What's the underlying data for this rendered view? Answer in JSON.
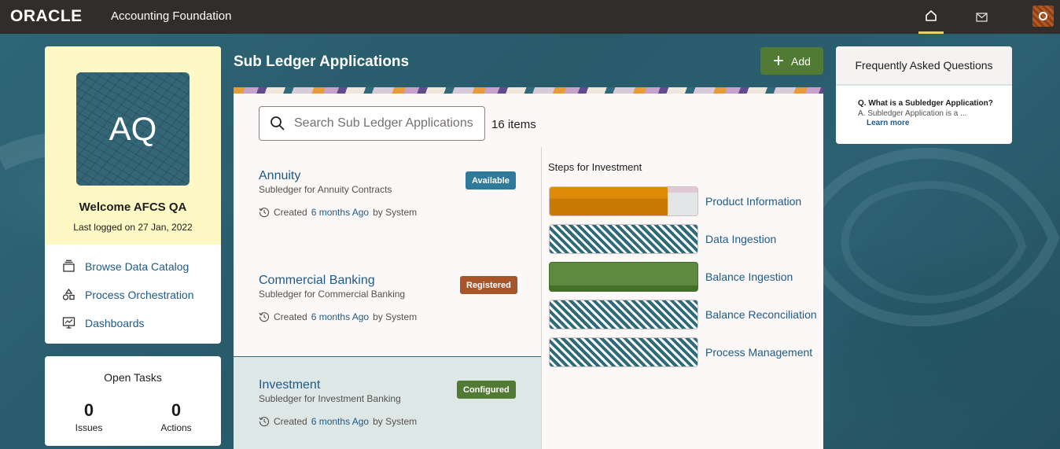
{
  "header": {
    "brand": "ORACLE",
    "app_title": "Accounting Foundation",
    "icons": [
      "home-icon",
      "mail-icon",
      "user-avatar-icon"
    ]
  },
  "profile": {
    "initials": "AQ",
    "welcome": "Welcome AFCS QA",
    "last_logged": "Last logged on 27 Jan, 2022",
    "links": [
      {
        "label": "Browse Data Catalog",
        "icon": "catalog-icon"
      },
      {
        "label": "Process Orchestration",
        "icon": "orchestration-icon"
      },
      {
        "label": "Dashboards",
        "icon": "dashboard-icon"
      }
    ]
  },
  "tasks": {
    "title": "Open Tasks",
    "issues_count": "0",
    "issues_label": "Issues",
    "actions_count": "0",
    "actions_label": "Actions"
  },
  "main": {
    "title": "Sub Ledger Applications",
    "add_label": "Add",
    "search_placeholder": "Search Sub Ledger Applications",
    "item_count": "16 items",
    "apps": [
      {
        "name": "Annuity",
        "desc": "Subledger for Annuity Contracts",
        "status": "Available",
        "status_color": "#2f7a9a",
        "created_prefix": "Created",
        "created_link": "6 months Ago",
        "created_suffix": "by System"
      },
      {
        "name": "Commercial Banking",
        "desc": "Subledger for Commercial Banking",
        "status": "Registered",
        "status_color": "#a9552a",
        "created_prefix": "Created",
        "created_link": "6 months Ago",
        "created_suffix": "by System"
      },
      {
        "name": "Investment",
        "desc": "Subledger for Investment Banking",
        "status": "Configured",
        "status_color": "#517a35",
        "created_prefix": "Created",
        "created_link": "6 months Ago",
        "created_suffix": "by System"
      }
    ],
    "steps_title": "Steps for Investment",
    "steps": [
      {
        "label": "Product Information",
        "state": "in-progress",
        "progress": 0.8
      },
      {
        "label": "Data Ingestion",
        "state": "pending"
      },
      {
        "label": "Balance Ingestion",
        "state": "complete"
      },
      {
        "label": "Balance Reconciliation",
        "state": "pending"
      },
      {
        "label": "Process Management",
        "state": "pending"
      }
    ]
  },
  "faq": {
    "title": "Frequently Asked Questions",
    "question": "Q. What is a Subledger Application?",
    "answer": "A. Subledger Application is a ...",
    "more": "Learn more"
  },
  "colors": {
    "accent": "#1e5a88",
    "topbar": "#312d2a",
    "add_button": "#517a35",
    "profile_bg": "#fdf8c4"
  }
}
